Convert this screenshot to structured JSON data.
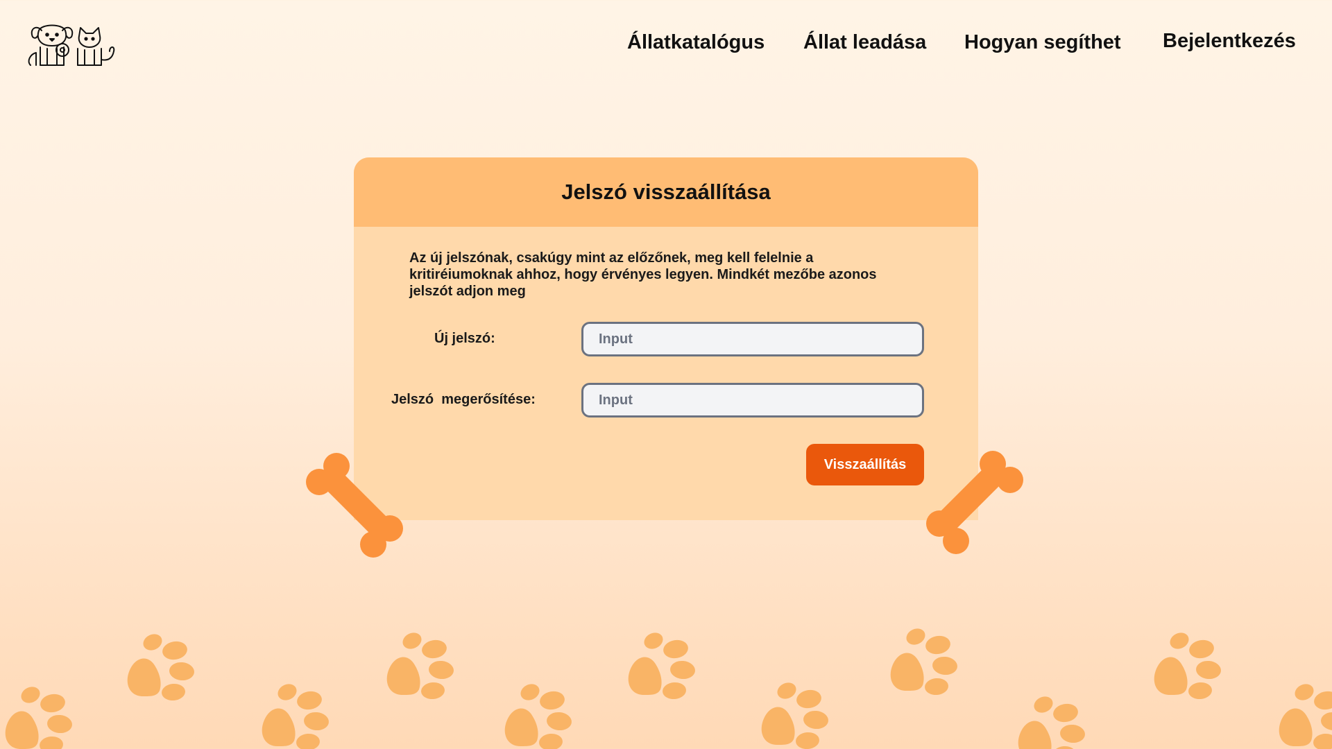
{
  "header": {
    "logo_icon": "dog-and-cat-logo-icon",
    "nav": [
      {
        "label": "Állatkatalógus"
      },
      {
        "label": "Állat leadása"
      },
      {
        "label": "Hogyan segíthet"
      },
      {
        "label": "Bejelentkezés"
      }
    ]
  },
  "card": {
    "title": "Jelszó visszaállítása",
    "description": "Az új jelszónak, csakúgy mint az előzőnek, meg kell felelnie a kritiréiumoknak ahhoz, hogy érvényes legyen. Mindkét mezőbe azonos jelszót adjon meg",
    "fields": [
      {
        "label": "Új jelszó:",
        "placeholder": "Input",
        "value": ""
      },
      {
        "label": "Jelszó  megerősítése:",
        "placeholder": "Input",
        "value": ""
      }
    ],
    "submit_label": "Visszaállítás"
  },
  "decorations": {
    "bone_icon": "bone-icon",
    "paw_icon": "paw-print-icon"
  },
  "colors": {
    "background_top": "#fff4e6",
    "background_bottom": "#ffd9b6",
    "card_header": "#ffbc74",
    "card_body": "#ffd9ab",
    "button": "#ea580c",
    "bone": "#fb923c",
    "paw": "#f9b466"
  }
}
